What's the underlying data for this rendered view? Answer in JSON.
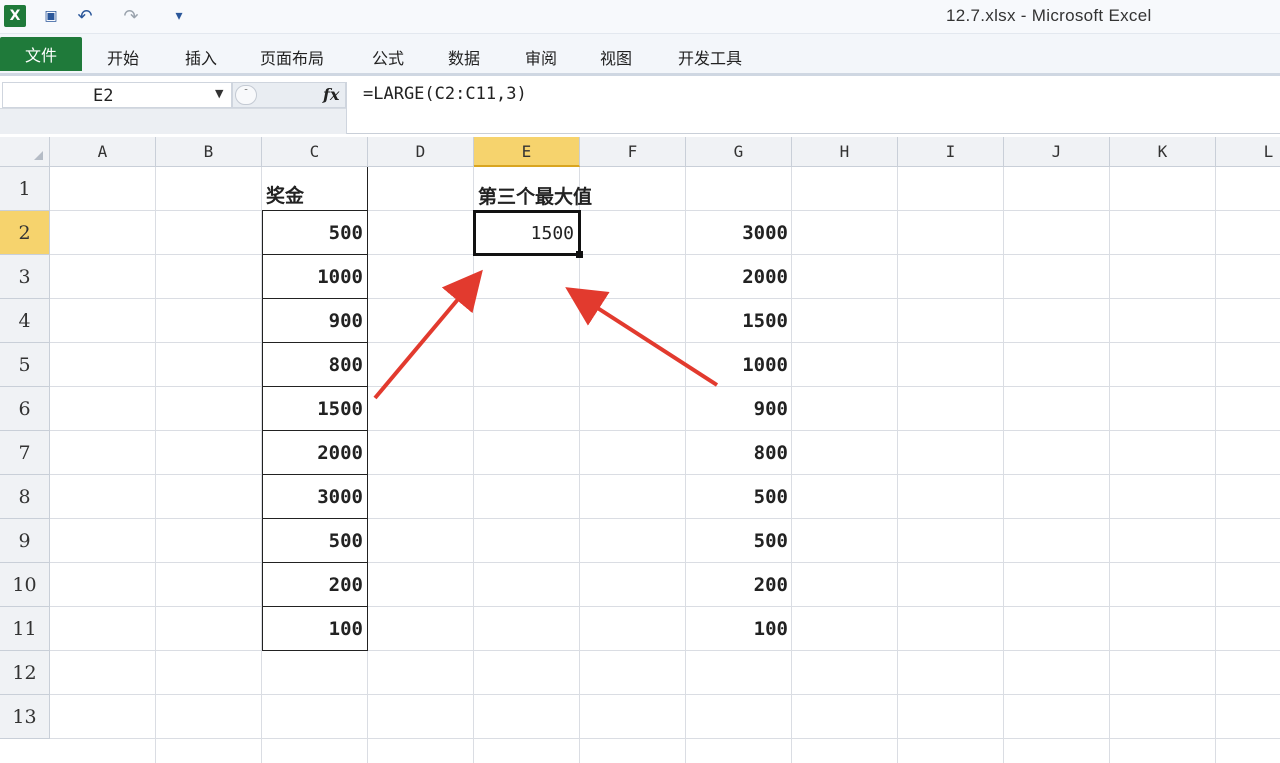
{
  "window": {
    "title": "12.7.xlsx  -  Microsoft Excel",
    "quick_access": [
      {
        "icon": "excel-logo-icon",
        "glyph": "X"
      },
      {
        "icon": "save-icon",
        "glyph": "▣"
      },
      {
        "icon": "undo-icon",
        "glyph": "↶"
      },
      {
        "icon": "redo-icon",
        "glyph": "↷"
      },
      {
        "icon": "customize-qa-icon",
        "glyph": "▾"
      }
    ]
  },
  "ribbon": {
    "file_tab": "文件",
    "tabs": [
      "开始",
      "插入",
      "页面布局",
      "公式",
      "数据",
      "审阅",
      "视图",
      "开发工具"
    ]
  },
  "formula_bar": {
    "name_box": "E2",
    "fx_label": "fx",
    "formula": "=LARGE(C2:C11,3)"
  },
  "sheet": {
    "columns": [
      "A",
      "B",
      "C",
      "D",
      "E",
      "F",
      "G",
      "H",
      "I",
      "J",
      "K",
      "L"
    ],
    "active_column": "E",
    "rows": [
      1,
      2,
      3,
      4,
      5,
      6,
      7,
      8,
      9,
      10,
      11,
      12,
      13
    ],
    "active_row": 2,
    "c_header": "奖金",
    "c_values": [
      "500",
      "1000",
      "900",
      "800",
      "1500",
      "2000",
      "3000",
      "500",
      "200",
      "100"
    ],
    "e_header": "第三个最大值",
    "e2_value": "1500",
    "g_values": [
      "3000",
      "2000",
      "1500",
      "1000",
      "900",
      "800",
      "500",
      "500",
      "200",
      "100"
    ]
  },
  "colors": {
    "file_tab": "#1f7a3a",
    "selected_header": "#f6d36d",
    "arrow": "#e23a2e"
  }
}
